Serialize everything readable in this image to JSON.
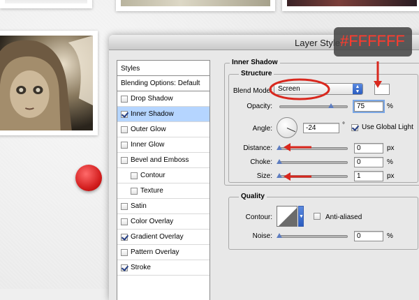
{
  "callout": {
    "text": "#FFFFFF"
  },
  "dialog": {
    "title": "Layer Style"
  },
  "styles_panel": {
    "header": "Styles",
    "blending_options": "Blending Options: Default",
    "items": [
      {
        "label": "Drop Shadow",
        "checked": false,
        "indent": false,
        "selected": false
      },
      {
        "label": "Inner Shadow",
        "checked": true,
        "indent": false,
        "selected": true
      },
      {
        "label": "Outer Glow",
        "checked": false,
        "indent": false,
        "selected": false
      },
      {
        "label": "Inner Glow",
        "checked": false,
        "indent": false,
        "selected": false
      },
      {
        "label": "Bevel and Emboss",
        "checked": false,
        "indent": false,
        "selected": false
      },
      {
        "label": "Contour",
        "checked": false,
        "indent": true,
        "selected": false
      },
      {
        "label": "Texture",
        "checked": false,
        "indent": true,
        "selected": false
      },
      {
        "label": "Satin",
        "checked": false,
        "indent": false,
        "selected": false
      },
      {
        "label": "Color Overlay",
        "checked": false,
        "indent": false,
        "selected": false
      },
      {
        "label": "Gradient Overlay",
        "checked": true,
        "indent": false,
        "selected": false
      },
      {
        "label": "Pattern Overlay",
        "checked": false,
        "indent": false,
        "selected": false
      },
      {
        "label": "Stroke",
        "checked": true,
        "indent": false,
        "selected": false
      }
    ]
  },
  "inner_shadow": {
    "section_title": "Inner Shadow",
    "structure_title": "Structure",
    "blend_mode_label": "Blend Mode:",
    "blend_mode_value": "Screen",
    "opacity_label": "Opacity:",
    "opacity_value": "75",
    "opacity_unit": "%",
    "opacity_level": 0.75,
    "angle_label": "Angle:",
    "angle_value": "-24",
    "angle_unit": "°",
    "use_global_light_label": "Use Global Light",
    "use_global_light_checked": true,
    "distance_label": "Distance:",
    "distance_value": "0",
    "distance_unit": "px",
    "choke_label": "Choke:",
    "choke_value": "0",
    "choke_unit": "%",
    "size_label": "Size:",
    "size_value": "1",
    "size_unit": "px",
    "swatch_color": "#FFFFFF"
  },
  "quality": {
    "title": "Quality",
    "contour_label": "Contour:",
    "anti_aliased_label": "Anti-aliased",
    "anti_aliased_checked": false,
    "noise_label": "Noise:",
    "noise_value": "0",
    "noise_unit": "%"
  },
  "colors": {
    "accent_red": "#D9281E",
    "selection_blue": "#B5D5FF",
    "callout_text": "#FF3B2D"
  }
}
